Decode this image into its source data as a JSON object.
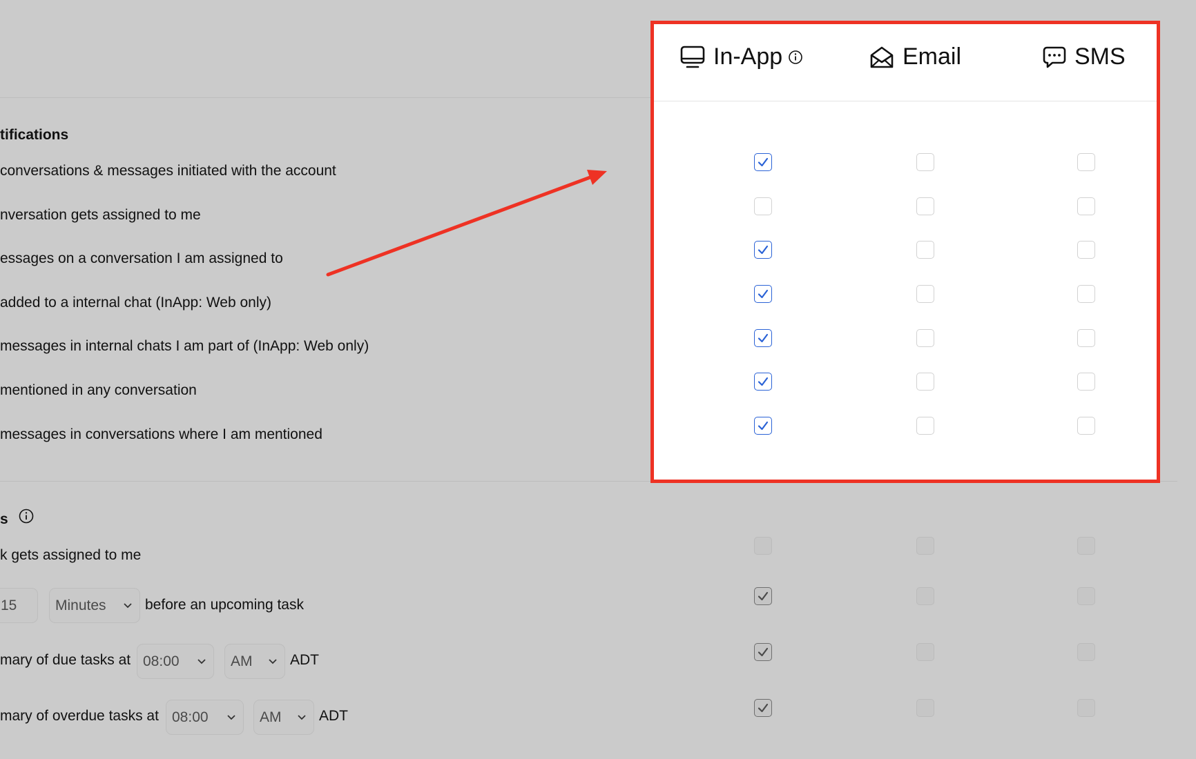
{
  "columns": [
    {
      "key": "inapp",
      "label": "In-App",
      "icon": "monitor-icon",
      "has_info": true
    },
    {
      "key": "email",
      "label": "Email",
      "icon": "envelope-open-icon",
      "has_info": false
    },
    {
      "key": "sms",
      "label": "SMS",
      "icon": "chat-bubble-icon",
      "has_info": false
    }
  ],
  "conversations": {
    "title": "tifications",
    "rows": [
      {
        "label": "conversations & messages initiated with the account",
        "values": [
          true,
          false,
          false
        ]
      },
      {
        "label": "nversation gets assigned to me",
        "values": [
          false,
          false,
          false
        ]
      },
      {
        "label": "essages on a conversation I am assigned to",
        "values": [
          true,
          false,
          false
        ]
      },
      {
        "label": "added to a internal chat (InApp: Web only)",
        "values": [
          true,
          false,
          false
        ]
      },
      {
        "label": "messages in internal chats I am part of (InApp: Web only)",
        "values": [
          true,
          false,
          false
        ]
      },
      {
        "label": "mentioned in any conversation",
        "values": [
          true,
          false,
          false
        ]
      },
      {
        "label": "messages in conversations where I am mentioned",
        "values": [
          true,
          false,
          false
        ]
      }
    ]
  },
  "tasks": {
    "title": "s",
    "row1": {
      "label": "k gets assigned to me",
      "values": [
        false,
        false,
        false
      ]
    },
    "row2": {
      "amount": "15",
      "unit": "Minutes",
      "suffix": "before an upcoming task",
      "values": [
        true,
        false,
        false
      ]
    },
    "row3": {
      "prefix": "mary of due tasks at",
      "time": "08:00",
      "ampm": "AM",
      "tz": "ADT",
      "values": [
        true,
        false,
        false
      ]
    },
    "row4": {
      "prefix": "mary of overdue tasks at",
      "time": "08:00",
      "ampm": "AM",
      "tz": "ADT",
      "values": [
        true,
        false,
        false
      ]
    }
  },
  "colors": {
    "highlight": "#ee3224",
    "checkbox_accent": "#2a62d6",
    "background": "#cbcbcb"
  }
}
